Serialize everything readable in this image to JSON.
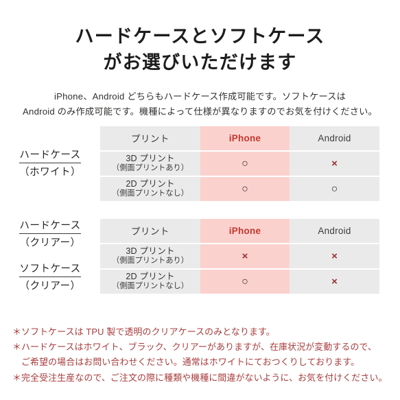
{
  "title": {
    "line1": "ハードケースとソフトケース",
    "line2": "がお選びいただけます"
  },
  "subtitle": {
    "line1": "iPhone、Android どちらもハードケース作成可能です。ソフトケースは",
    "line2": "Android のみ作成可能です。機種によって仕様が異なりますのでお気を付けください。"
  },
  "colors": {
    "header_gray": "#ebeaea",
    "header_pink": "#fbd1ce",
    "accent_red": "#c2372f",
    "note_red": "#a83c3c",
    "mark_circle": "#2e2c2c",
    "mark_cross": "#963232"
  },
  "sections": [
    {
      "labels": [
        {
          "main": "ハードケース",
          "sub": "（ホワイト）"
        }
      ],
      "columns": [
        "プリント",
        "iPhone",
        "Android"
      ],
      "rows": [
        {
          "print_main": "3D プリント",
          "print_note": "（側面プリントあり）",
          "iphone": "○",
          "android": "×"
        },
        {
          "print_main": "2D プリント",
          "print_note": "（側面プリントなし）",
          "iphone": "○",
          "android": "○"
        }
      ]
    },
    {
      "labels": [
        {
          "main": "ハードケース",
          "sub": "（クリアー）"
        },
        {
          "main": "ソフトケース",
          "sub": "（クリアー）"
        }
      ],
      "columns": [
        "プリント",
        "iPhone",
        "Android"
      ],
      "rows": [
        {
          "print_main": "3D プリント",
          "print_note": "（側面プリントあり）",
          "iphone": "×",
          "android": "×"
        },
        {
          "print_main": "2D プリント",
          "print_note": "（側面プリントなし）",
          "iphone": "○",
          "android": "×"
        }
      ]
    }
  ],
  "notes": [
    {
      "text": "＊ソフトケースは TPU 製で透明のクリアケースのみとなります。",
      "indent": false
    },
    {
      "text": "＊ハードケースはホワイト、ブラック、クリアーがありますが、在庫状況が変動するので、",
      "indent": false
    },
    {
      "text": "ご希望の場合はお問い合わせください。通常はホワイトにておつくりしております。",
      "indent": true
    },
    {
      "text": "＊完全受注生産なので、ご注文の際に種類や機種に間違がないように、お気を付けください。",
      "indent": false
    }
  ]
}
